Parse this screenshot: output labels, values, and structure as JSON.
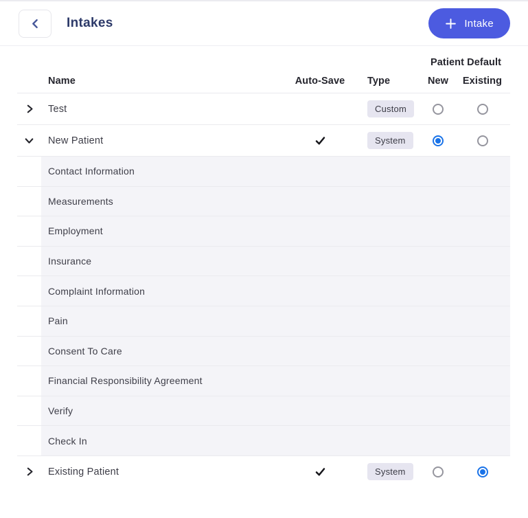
{
  "header": {
    "title": "Intakes",
    "add_button_label": "Intake"
  },
  "table": {
    "columns": {
      "name": "Name",
      "auto_save": "Auto-Save",
      "type": "Type",
      "patient_default_group": "Patient Default",
      "new": "New",
      "existing": "Existing"
    },
    "rows": [
      {
        "name": "Test",
        "expanded": false,
        "auto_save": false,
        "type": "Custom",
        "default_new": false,
        "default_existing": false,
        "children": []
      },
      {
        "name": "New Patient",
        "expanded": true,
        "auto_save": true,
        "type": "System",
        "default_new": true,
        "default_existing": false,
        "children": [
          "Contact Information",
          "Measurements",
          "Employment",
          "Insurance",
          "Complaint Information",
          "Pain",
          "Consent To Care",
          "Financial Responsibility Agreement",
          "Verify",
          "Check In"
        ]
      },
      {
        "name": "Existing Patient",
        "expanded": false,
        "auto_save": true,
        "type": "System",
        "default_new": false,
        "default_existing": true,
        "children": []
      }
    ]
  },
  "colors": {
    "accent_button": "#4c5be0",
    "title_text": "#2d3a69",
    "radio_selected": "#1a73e8",
    "radio_unselected_border": "#95959e",
    "badge_background": "#e6e5f0",
    "subrow_background": "#f4f4f8",
    "divider": "#eaeaee",
    "header_text": "#26262e",
    "row_text": "#3d3d47"
  },
  "icons": {
    "back": "chevron-left-icon",
    "add": "plus-icon",
    "expand": "chevron-right-icon",
    "collapse": "chevron-down-icon",
    "auto_save": "check-icon"
  }
}
